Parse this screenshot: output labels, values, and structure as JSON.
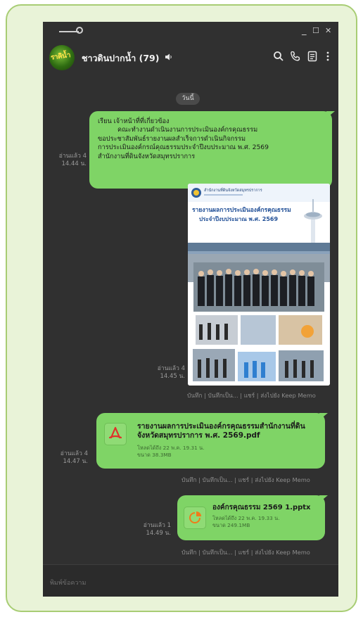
{
  "window": {
    "minimize_glyph": "_",
    "maximize_glyph": "☐",
    "close_glyph": "✕"
  },
  "header": {
    "avatar_text": "ราคิน้ำ",
    "chat_title": "ชาวดินปากน้ำ (79)",
    "mute_icon": "speaker-icon",
    "icons": [
      "search-icon",
      "phone-icon",
      "notes-icon",
      "more-icon"
    ]
  },
  "date_label": "วันนี้",
  "messages": {
    "m1": {
      "lines": [
        "เรียน เจ้าหน้าที่ที่เกี่ยวข้อง",
        "คณะทำงานดำเนินงานการประเมินองค์กรคุณธรรม",
        "ขอประชาสัมพันธ์รายงานผลสำเร็จการดำเนินกิจกรรม",
        "การประเมินองค์กรณ์คุณธรรมประจำปีงบประมาณ พ.ศ. 2569",
        "สำนักงานที่ดินจังหวัดสมุทรปราการ"
      ],
      "read": "อ่านแล้ว 4",
      "time": "14.44 น."
    },
    "m2": {
      "image": {
        "header_text": "สำนักงานที่ดินจังหวัดสมุทรปราการ",
        "title_line1": "รายงานผลการประเมินองค์กรคุณธรรม",
        "title_line2": "ประจำปีงบประมาณ พ.ศ. 2569"
      },
      "read": "อ่านแล้ว 4",
      "time": "14.45 น.",
      "actions": "บันทึก | บันทึกเป็น... | แชร์ | ส่งไปยัง Keep Memo"
    },
    "m3": {
      "file_icon": "pdf-icon",
      "file_name": "รายงานผลการประเมินองค์กรคุณธรรมสำนักงานที่ดินจังหวัดสมุทรปราการ พ.ศ. 2569.pdf",
      "expiry": "โหลดได้ถึง 22 พ.ค. 19.31 น.",
      "size": "ขนาด 38.3MB",
      "read": "อ่านแล้ว 4",
      "time": "14.47 น.",
      "actions": "บันทึก | บันทึกเป็น... | แชร์ | ส่งไปยัง Keep Memo"
    },
    "m4": {
      "file_icon": "pptx-icon",
      "file_name": "องค์กรคุณธรรม 2569 1.pptx",
      "expiry": "โหลดได้ถึง 22 พ.ค. 19.33 น.",
      "size": "ขนาด 249.1MB",
      "read": "อ่านแล้ว 1",
      "time": "14.49 น.",
      "actions": "บันทึก | บันทึกเป็น... | แชร์ | ส่งไปยัง Keep Memo"
    }
  },
  "input": {
    "placeholder": "พิมพ์ข้อความ"
  },
  "colors": {
    "bubble": "#7fd466",
    "window_bg": "#303030",
    "frame": "#a8cd74",
    "pdf_red": "#e0312a",
    "pptx_orange": "#f07a1a"
  }
}
